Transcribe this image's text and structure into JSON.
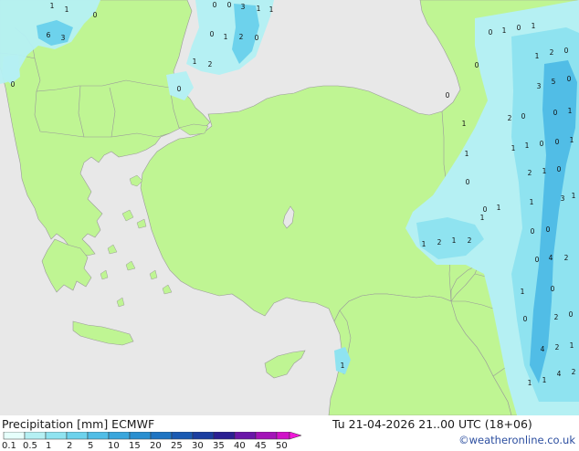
{
  "map": {
    "land_color": "#bff593",
    "sea_color": "#e8e8e8",
    "border_color": "#9a9a9a",
    "precip_colors": [
      "#e6fffb",
      "#b5f0f3",
      "#8fe3f0",
      "#6dd2ec",
      "#51bde6",
      "#3aa6dc"
    ],
    "cell_values": [
      {
        "v": "1"
      },
      {
        "v": "1"
      },
      {
        "v": "0"
      },
      {
        "v": "0"
      },
      {
        "v": "0"
      },
      {
        "v": "3"
      },
      {
        "v": "1"
      },
      {
        "v": "1"
      },
      {
        "v": "6"
      },
      {
        "v": "3"
      },
      {
        "v": "0"
      },
      {
        "v": "1"
      },
      {
        "v": "2"
      },
      {
        "v": "0"
      },
      {
        "v": "1"
      },
      {
        "v": "2"
      },
      {
        "v": "0"
      },
      {
        "v": "0"
      },
      {
        "v": "0"
      },
      {
        "v": "1"
      },
      {
        "v": "0"
      },
      {
        "v": "1"
      },
      {
        "v": "1"
      },
      {
        "v": "2"
      },
      {
        "v": "0"
      },
      {
        "v": "0"
      },
      {
        "v": "3"
      },
      {
        "v": "5"
      },
      {
        "v": "0"
      },
      {
        "v": "0"
      },
      {
        "v": "2"
      },
      {
        "v": "0"
      },
      {
        "v": "0"
      },
      {
        "v": "1"
      },
      {
        "v": "1"
      },
      {
        "v": "0"
      },
      {
        "v": "0"
      },
      {
        "v": "1"
      },
      {
        "v": "1"
      },
      {
        "v": "1"
      },
      {
        "v": "1"
      },
      {
        "v": "2"
      },
      {
        "v": "1"
      },
      {
        "v": "0"
      },
      {
        "v": "0"
      },
      {
        "v": "0"
      },
      {
        "v": "1"
      },
      {
        "v": "1"
      },
      {
        "v": "3"
      },
      {
        "v": "0"
      },
      {
        "v": "1"
      },
      {
        "v": "1"
      },
      {
        "v": "0"
      },
      {
        "v": "4"
      },
      {
        "v": "1"
      },
      {
        "v": "2"
      },
      {
        "v": "1"
      },
      {
        "v": "2"
      },
      {
        "v": "0"
      },
      {
        "v": "2"
      },
      {
        "v": "0"
      },
      {
        "v": "1"
      },
      {
        "v": "0"
      },
      {
        "v": "2"
      },
      {
        "v": "0"
      },
      {
        "v": "4"
      },
      {
        "v": "2"
      },
      {
        "v": "1"
      },
      {
        "v": "1"
      },
      {
        "v": "4"
      },
      {
        "v": "2"
      },
      {
        "v": "1"
      },
      {
        "v": "1"
      }
    ]
  },
  "footer": {
    "title": "Precipitation [mm]  ECMWF",
    "datetime": "Tu 21-04-2026 21..00 UTC (18+06)",
    "credit": "©weatheronline.co.uk",
    "legend_ticks": [
      "0.1",
      "0.5",
      "1",
      "2",
      "5",
      "10",
      "15",
      "20",
      "25",
      "30",
      "35",
      "40",
      "45",
      "50"
    ],
    "legend_colors": [
      "#e6fffb",
      "#b5f0f3",
      "#8fe3f0",
      "#6dd2ec",
      "#51bde6",
      "#3aa6dc",
      "#2a8fd0",
      "#1e74c2",
      "#1a5ab2",
      "#1b3ea0",
      "#2b1f92",
      "#6a16a8",
      "#a313b8",
      "#d010c8",
      "#f018d8"
    ]
  }
}
